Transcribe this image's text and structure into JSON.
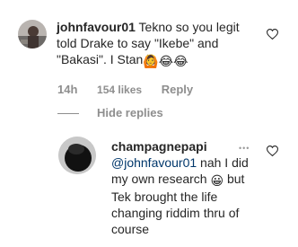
{
  "comment": {
    "username": "johnfavour01",
    "text_part1": "Tekno so you legit",
    "text_part2": "told Drake to say \"Ikebe\" and",
    "text_part3": "\"Bakasi\". I Stan",
    "emojis": "🙆😂😂",
    "time": "14h",
    "likes": "154 likes",
    "reply_label": "Reply",
    "hide_replies": "Hide replies"
  },
  "reply": {
    "username": "champagnepapi",
    "mention": "@johnfavour01",
    "line1_rest": " nah I did",
    "line2": "my own research",
    "emoji": "😀",
    "line2_rest": " but",
    "line3": "Tek brought the life",
    "line4": "changing riddim thru of",
    "line5": "course",
    "more": "•••"
  },
  "icons": {
    "heart": "heart-outline-icon",
    "more": "more-options-icon"
  }
}
